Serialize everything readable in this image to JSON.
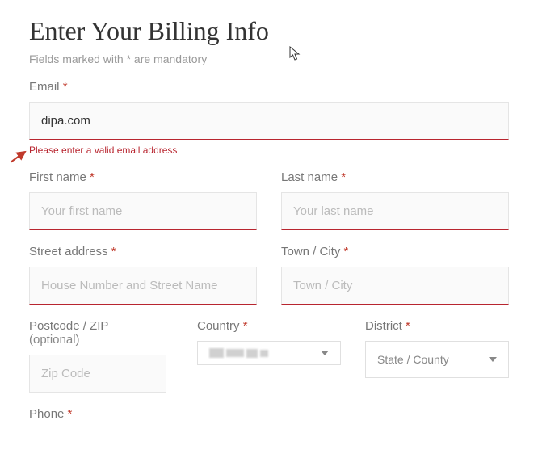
{
  "title": "Enter Your Billing Info",
  "subtitle": "Fields marked with * are mandatory",
  "email": {
    "label": "Email",
    "value": "dipa.com",
    "error": "Please enter a valid email address"
  },
  "first_name": {
    "label": "First name",
    "placeholder": "Your first name"
  },
  "last_name": {
    "label": "Last name",
    "placeholder": "Your last name"
  },
  "street": {
    "label": "Street address",
    "placeholder": "House Number and Street Name"
  },
  "city": {
    "label": "Town / City",
    "placeholder": "Town / City"
  },
  "postcode": {
    "label": "Postcode / ZIP",
    "optional": "(optional)",
    "placeholder": "Zip Code"
  },
  "country": {
    "label": "Country"
  },
  "district": {
    "label": "District",
    "placeholder": "State / County"
  },
  "phone": {
    "label": "Phone"
  },
  "asterisk": "*"
}
